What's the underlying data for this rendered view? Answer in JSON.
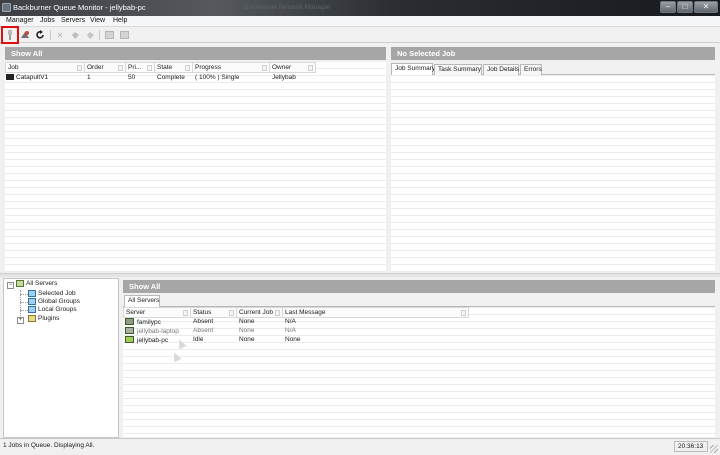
{
  "window": {
    "title": "Backburner Queue Monitor - jellybab-pc",
    "background_title": "Backburner Network Manager",
    "controls": [
      "–",
      "□",
      "✕"
    ]
  },
  "menu": [
    "Manager",
    "Jobs",
    "Servers",
    "View",
    "Help"
  ],
  "toolbar": {
    "icons": [
      "connect-icon",
      "job-settings-icon",
      "refresh-icon",
      "delete-icon",
      "activate-icon",
      "suspend-icon",
      "clone-icon",
      "archive-icon"
    ]
  },
  "jobs_panel": {
    "header": "Show All",
    "columns": [
      "Job",
      "Order",
      "Pri...",
      "State",
      "Progress",
      "Owner"
    ],
    "rows": [
      {
        "job": "CatapultV1",
        "order": "1",
        "priority": "50",
        "state": "Complete",
        "progress": "( 100% ) Single",
        "owner": "Jellybab"
      }
    ]
  },
  "details_panel": {
    "header": "No Selected Job",
    "tabs": [
      "Job Summary",
      "Task Summary",
      "Job Details",
      "Errors"
    ]
  },
  "tree": {
    "root": "All Servers",
    "children": [
      "Selected Job",
      "Global Groups",
      "Local Groups",
      "Plugins"
    ]
  },
  "servers_panel": {
    "header": "Show All",
    "tab": "All Servers",
    "columns": [
      "Server",
      "Status",
      "Current Job",
      "Last Message"
    ],
    "rows": [
      {
        "server": "familypc",
        "status": "Absent",
        "current_job": "None",
        "last_message": "N/A"
      },
      {
        "server": "jellybab-laptop",
        "status": "Absent",
        "current_job": "None",
        "last_message": "N/A"
      },
      {
        "server": "jellybab-pc",
        "status": "Idle",
        "current_job": "None",
        "last_message": "None"
      }
    ]
  },
  "status": {
    "message": "1 Jobs in Queue. Displaying All.",
    "time": "20:36:13"
  }
}
